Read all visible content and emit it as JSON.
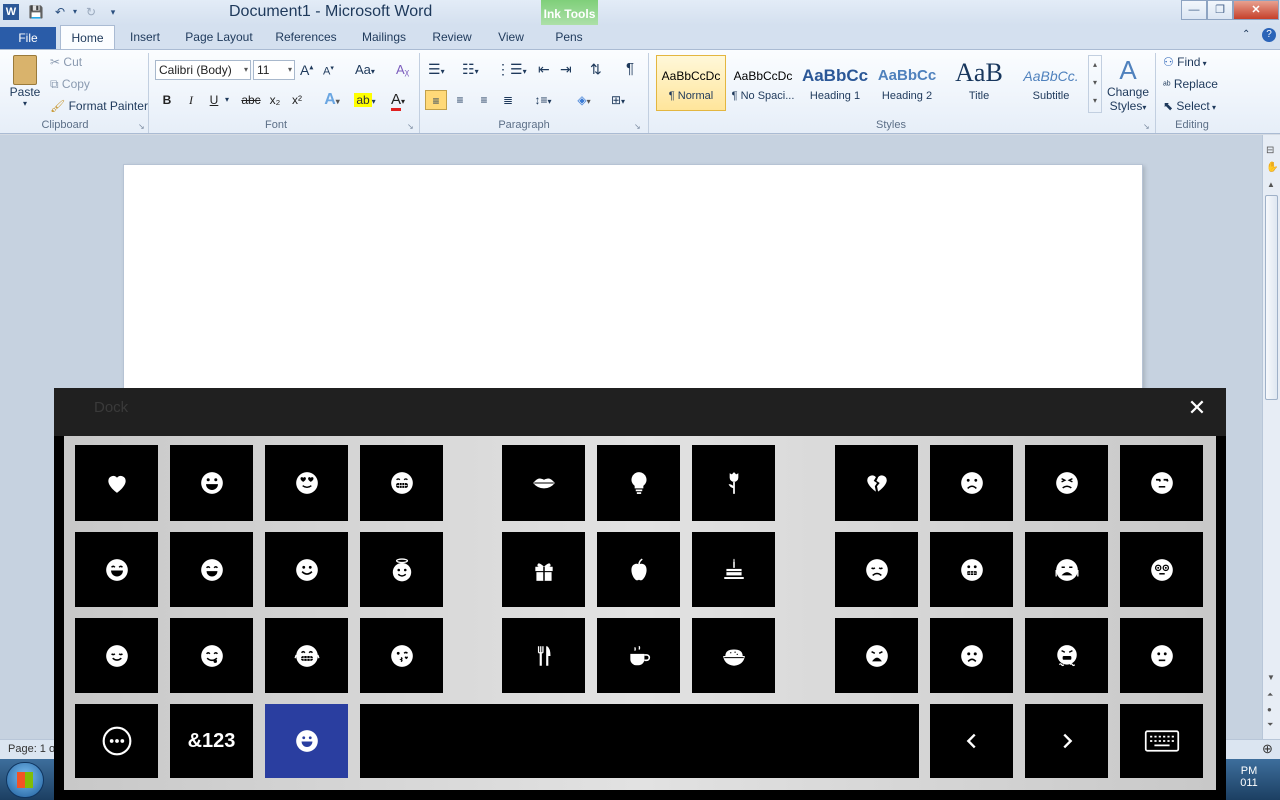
{
  "window": {
    "title": "Document1  -  Microsoft Word",
    "contextual_group": "Ink Tools",
    "app_icon": "W"
  },
  "tabs": [
    {
      "label": "File",
      "active": false,
      "file": true
    },
    {
      "label": "Home",
      "active": true
    },
    {
      "label": "Insert"
    },
    {
      "label": "Page Layout"
    },
    {
      "label": "References"
    },
    {
      "label": "Mailings"
    },
    {
      "label": "Review"
    },
    {
      "label": "View"
    },
    {
      "label": "Pens",
      "contextual": true
    }
  ],
  "clipboard": {
    "paste": "Paste",
    "cut": "Cut",
    "copy": "Copy",
    "format_painter": "Format Painter",
    "group": "Clipboard"
  },
  "font": {
    "family": "Calibri (Body)",
    "size": "11",
    "change_case": "Aa",
    "bold": "B",
    "italic": "I",
    "underline": "U",
    "strike": "abc",
    "subscript": "x₂",
    "superscript": "x²",
    "group": "Font"
  },
  "paragraph": {
    "group": "Paragraph",
    "pilcrow": "¶"
  },
  "styles": {
    "group": "Styles",
    "items": [
      {
        "preview": "AaBbCcDc",
        "label": "¶ Normal",
        "selected": true
      },
      {
        "preview": "AaBbCcDc",
        "label": "¶ No Spaci..."
      },
      {
        "preview": "AaBbCc",
        "label": "Heading 1"
      },
      {
        "preview": "AaBbCc",
        "label": "Heading 2"
      },
      {
        "preview": "AaB",
        "label": "Title"
      },
      {
        "preview": "AaBbCc.",
        "label": "Subtitle"
      }
    ],
    "change_styles_1": "Change",
    "change_styles_2": "Styles"
  },
  "editing": {
    "group": "Editing",
    "find": "Find",
    "replace": "Replace",
    "select": "Select"
  },
  "status": {
    "page": "Page: 1 o"
  },
  "taskbar": {
    "time": "PM",
    "date": "011"
  },
  "dock": {
    "title": "Dock",
    "symbols_key": "&123",
    "colors": {
      "key_bg": "#000000",
      "selected_bg": "#2a3ea0",
      "panel_bg": "#d5d5d5"
    }
  }
}
